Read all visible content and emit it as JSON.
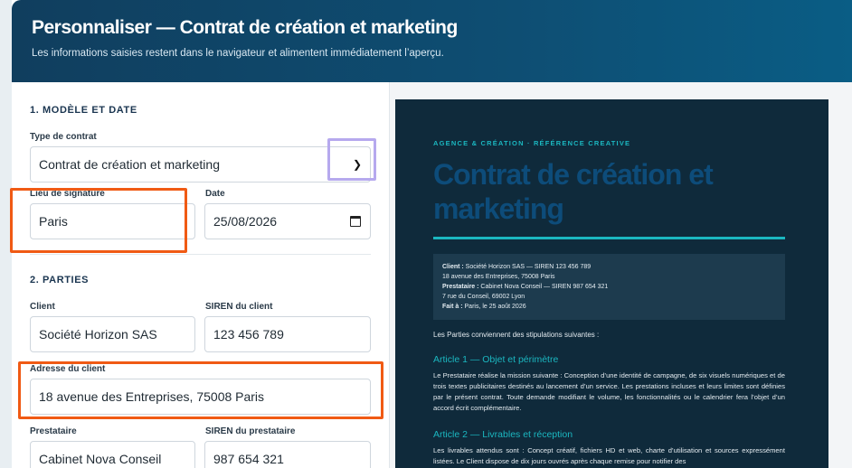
{
  "header": {
    "title": "Personnaliser — Contrat de création et marketing",
    "subtitle": "Les informations saisies restent dans le navigateur et alimentent immédiatement l’aperçu."
  },
  "form": {
    "section1": "1. MODÈLE ET DATE",
    "contract_type_label": "Type de contrat",
    "contract_type_value": "Contrat de création et marketing",
    "place_label": "Lieu de signature",
    "place_value": "Paris",
    "date_label": "Date",
    "date_value": "25/08/2026",
    "section2": "2. PARTIES",
    "client_label": "Client",
    "client_value": "Société Horizon SAS",
    "client_siren_label": "SIREN du client",
    "client_siren_value": "123 456 789",
    "client_address_label": "Adresse du client",
    "client_address_value": "18 avenue des Entreprises, 75008 Paris",
    "provider_label": "Prestataire",
    "provider_value": "Cabinet Nova Conseil",
    "provider_siren_label": "SIREN du prestataire",
    "provider_siren_value": "987 654 321"
  },
  "preview": {
    "kicker": "AGENCE & CRÉATION · RÉFÉRENCE CREATIVE",
    "title": "Contrat de création et marketing",
    "box": {
      "client_key": "Client :",
      "client_line": " Société Horizon SAS — SIREN 123 456 789",
      "client_address": "18 avenue des Entreprises, 75008 Paris",
      "provider_key": "Prestataire :",
      "provider_line": " Cabinet Nova Conseil — SIREN 987 654 321",
      "provider_address": "7 rue du Conseil, 69002 Lyon",
      "done_key": "Fait à :",
      "done_line": " Paris, le 25 août 2026"
    },
    "intro": "Les Parties conviennent des stipulations suivantes :",
    "article1_title": "Article 1 — Objet et périmètre",
    "article1_body": "Le Prestataire réalise la mission suivante : Conception d’une identité de campagne, de six visuels numériques et de trois textes publicitaires destinés au lancement d’un service. Les prestations incluses et leurs limites sont définies par le présent contrat. Toute demande modifiant le volume, les fonctionnalités ou le calendrier fera l’objet d’un accord écrit complémentaire.",
    "article2_title": "Article 2 — Livrables et réception",
    "article2_body": "Les livrables attendus sont : Concept créatif, fichiers HD et web, charte d’utilisation et sources expressément listées. Le Client dispose de dix jours ouvrés après chaque remise pour notifier des"
  },
  "colors": {
    "accent": "#1bb7c0",
    "header": "#0e4e73",
    "highlight_orange": "#f05a14",
    "highlight_purple": "#b6a9ee"
  }
}
